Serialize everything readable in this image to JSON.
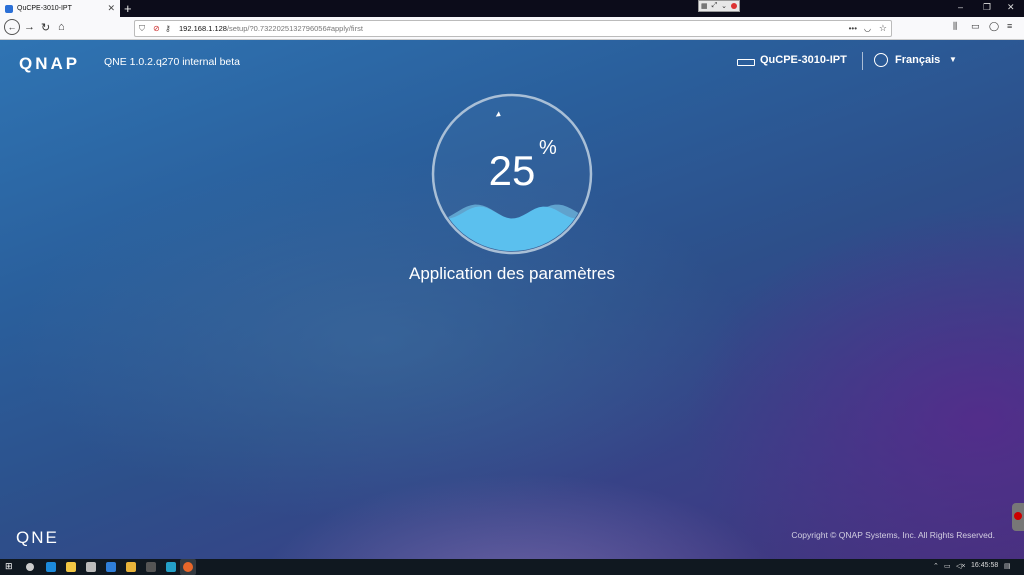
{
  "browser": {
    "tab": {
      "title": "QuCPE-3010-IPT"
    },
    "new_tab": "+",
    "url": {
      "host": "192.168.1.128",
      "path": "/setup/?0.7322025132796056#apply/first"
    }
  },
  "header": {
    "brand": "QNAP",
    "version": "QNE 1.0.2.q270 internal beta",
    "device_name": "QuCPE-3010-IPT",
    "language": "Français"
  },
  "progress": {
    "percent": 25,
    "percent_text": "25",
    "percent_sign": "%",
    "status": "Application des paramètres"
  },
  "footer": {
    "logo_text": "QNE",
    "copyright": "Copyright © QNAP Systems, Inc. All Rights Reserved."
  },
  "taskbar": {
    "clock": "16:45:58"
  },
  "colors": {
    "wave": "#5bc0ee",
    "wave_back": "#7fd0f2",
    "ring": "#a9bfd6"
  }
}
